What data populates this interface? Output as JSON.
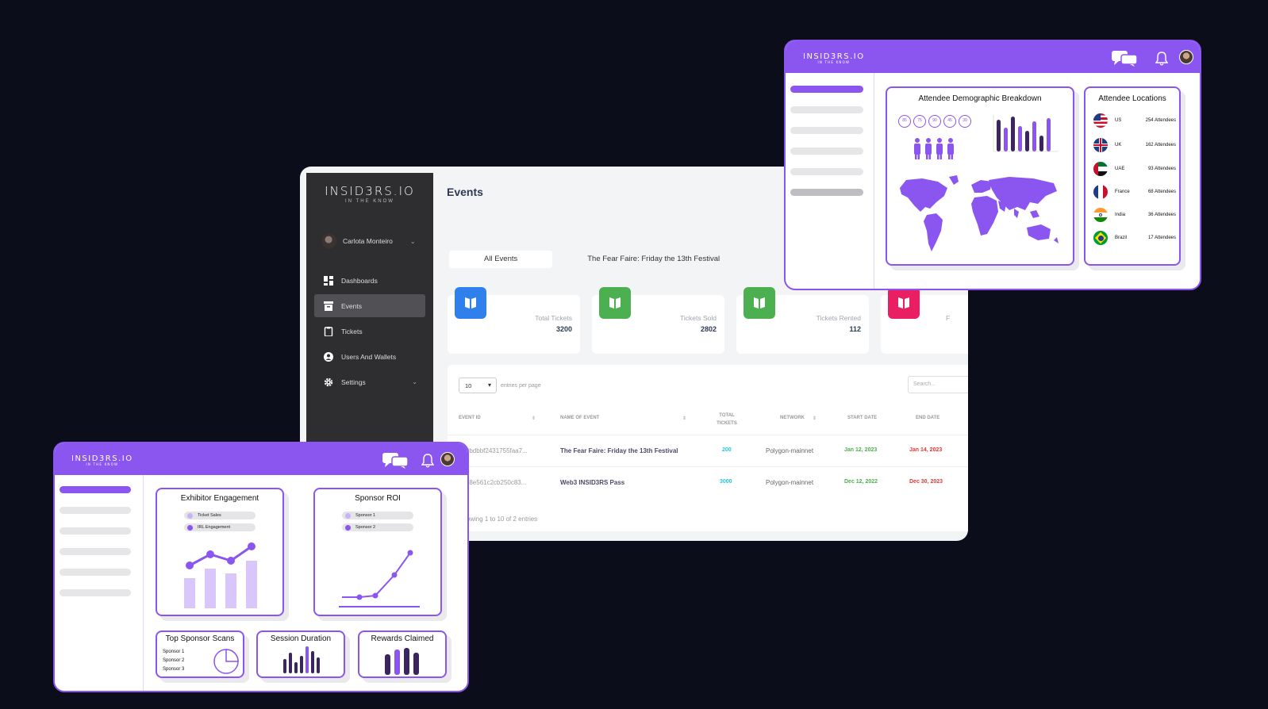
{
  "main": {
    "brand": "INSID3RS.IO",
    "tagline": "IN THE KNOW",
    "user_name": "Carlota Monteiro",
    "nav": [
      {
        "label": "Dashboards",
        "icon": "dashboard-icon"
      },
      {
        "label": "Events",
        "icon": "archive-icon",
        "active": true
      },
      {
        "label": "Tickets",
        "icon": "clipboard-icon"
      },
      {
        "label": "Users And Wallets",
        "icon": "user-circle-icon"
      },
      {
        "label": "Settings",
        "icon": "gear-icon"
      }
    ],
    "page_title": "Events",
    "tabs": [
      "All Events",
      "The Fear Faire: Friday the 13th Festival"
    ],
    "stats": [
      {
        "label": "Total Tickets",
        "value": "3200",
        "color": "#2f80ed"
      },
      {
        "label": "Tickets Sold",
        "value": "2802",
        "color": "#4caf50"
      },
      {
        "label": "Tickets Rented",
        "value": "112",
        "color": "#4caf50"
      },
      {
        "label": "F",
        "value": "",
        "color": "#e91e63"
      }
    ],
    "entries_value": "10",
    "entries_label": "entries per page",
    "search_placeholder": "Search...",
    "columns": [
      "EVENT ID",
      "NAME OF EVENT",
      "TOTAL TICKETS",
      "NETWORK",
      "START DATE",
      "END DATE"
    ],
    "rows": [
      {
        "id": "639bdbbf2431755faa7...",
        "name": "The Fear Faire: Friday the 13th Festival",
        "total": "200",
        "network": "Polygon-mainnet",
        "start": "Jan 12, 2023",
        "end": "Jan 14, 2023"
      },
      {
        "id": "6398e561c2cb250c83...",
        "name": "Web3 INSID3RS Pass",
        "total": "3000",
        "network": "Polygon-mainnet",
        "start": "Dec 12, 2022",
        "end": "Dec 30, 2023"
      }
    ],
    "footer": "Showing 1 to 10 of 2 entries"
  },
  "attendee_window": {
    "brand": "INSID3RS.IO",
    "tagline": "IN THE KNOW",
    "demographic_title": "Attendee Demographic Breakdown",
    "age_circles": [
      "85",
      "75",
      "90",
      "45",
      "30"
    ],
    "locations_title": "Attendee Locations",
    "locations": [
      {
        "country": "US",
        "count": "254 Attendees"
      },
      {
        "country": "UK",
        "count": "162 Attendees"
      },
      {
        "country": "UAE",
        "count": "93 Attendees"
      },
      {
        "country": "France",
        "count": "68 Attendees"
      },
      {
        "country": "India",
        "count": "36 Attendees"
      },
      {
        "country": "Brazil",
        "count": "17 Attendees"
      }
    ]
  },
  "sponsor_window": {
    "brand": "INSID3RS.IO",
    "tagline": "IN THE KNOW",
    "exhibitor_title": "Exhibitor Engagement",
    "exhibitor_legend": [
      "Ticket Sales",
      "IRL Engagement"
    ],
    "roi_title": "Sponsor ROI",
    "roi_legend": [
      "Sponsor 1",
      "Sponsor 2"
    ],
    "scans_title": "Top Sponsor Scans",
    "scans_list": [
      "Sponsor 1",
      "Sponsor 2",
      "Sponsor 3"
    ],
    "session_title": "Session Duration",
    "rewards_title": "Rewards Claimed"
  },
  "colors": {
    "accent": "#8b55ef",
    "accent_dark": "#3b2560",
    "green": "#4caf50",
    "red": "#e53935",
    "cyan": "#26c6da"
  }
}
